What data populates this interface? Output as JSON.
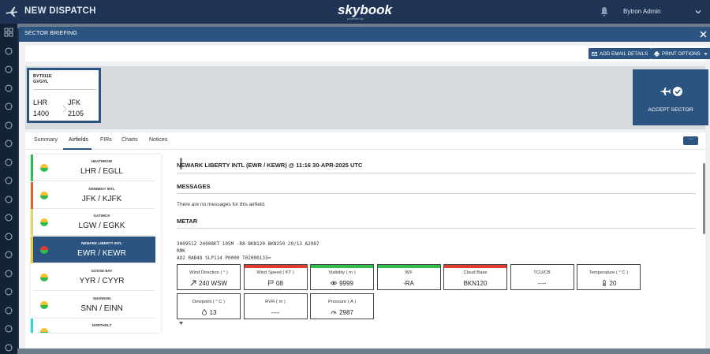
{
  "app": {
    "title": "NEW DISPATCH",
    "brand": "skybook",
    "brand_sub": "powered by",
    "user": "Bytron Admin"
  },
  "sidebar": {
    "icons": [
      "grid-icon",
      "plane-icon",
      "plane-depart-icon",
      "globe-icon",
      "calendar-icon",
      "list-icon",
      "plane-arrive-icon",
      "folder-icon",
      "pin-icon",
      "map-icon",
      "clipboard-icon",
      "table-icon",
      "chart-icon",
      "book-icon",
      "people-icon",
      "users-icon",
      "report-icon",
      "settings-icon"
    ]
  },
  "modal": {
    "title": "SECTOR BRIEFING",
    "email_button": "ADD EMAIL DETAILS",
    "print_button": "PRINT OPTIONS"
  },
  "sector": {
    "flight": "BYT011E",
    "registration": "GVGYL",
    "origin": "LHR",
    "origin_time": "1400",
    "destination": "JFK",
    "destination_time": "2105",
    "accept_label": "ACCEPT SECTOR"
  },
  "tabs": [
    {
      "label": "Summary"
    },
    {
      "label": "Airfields"
    },
    {
      "label": "FIRs"
    },
    {
      "label": "Charts"
    },
    {
      "label": "Notices"
    }
  ],
  "active_tab": "Airfields",
  "more_label": "···",
  "airfields": [
    {
      "name": "HEATHROW",
      "code": "LHR / EGLL",
      "stripe": "#2ebd4e",
      "top": "#f2c230",
      "bottom": "#2ebd4e",
      "selected": false
    },
    {
      "name": "KENNEDY INTL",
      "code": "JFK / KJFK",
      "stripe": "#e2622d",
      "top": "#f2c230",
      "bottom": "#2ebd4e",
      "selected": false
    },
    {
      "name": "GATWICK",
      "code": "LGW / EGKK",
      "stripe": "#d9d96a",
      "top": "#f2c230",
      "bottom": "#2ebd4e",
      "selected": false
    },
    {
      "name": "NEWARK LIBERTY INTL",
      "code": "EWR / KEWR",
      "stripe": "#e8c63a",
      "top": "#e03b2f",
      "bottom": "#2ebd4e",
      "selected": true
    },
    {
      "name": "GOOSE BAY",
      "code": "YYR / CYYR",
      "stripe": "#ffffff",
      "top": "#f2c230",
      "bottom": "#2ebd4e",
      "selected": false
    },
    {
      "name": "SHANNON",
      "code": "SNN / EINN",
      "stripe": "#ffffff",
      "top": "#f2c230",
      "bottom": "#2ebd4e",
      "selected": false
    },
    {
      "name": "NORTHOLT",
      "code": "",
      "stripe": "#3ad1d1",
      "top": "#f2c230",
      "bottom": "#2ebd4e",
      "selected": false
    }
  ],
  "detail": {
    "title": "NEWARK LIBERTY INTL (EWR / KEWR) @ 11:16 30-APR-2025 UTC",
    "messages_heading": "MESSAGES",
    "messages_text": "There are no messages for this airfield.",
    "metar_heading": "METAR",
    "metar_line1": "300951Z 24008KT 10SM -RA BKN120 BKN250 20/13 A2987",
    "metar_line2": "RMK",
    "metar_line3": "AO2 RAB48 SLP114 P0000 T02000133="
  },
  "metar_boxes": [
    {
      "label": "Wind Direction ( ° )",
      "value": "240 WSW",
      "icon": "wind-arrow-icon",
      "bar": ""
    },
    {
      "label": "Wind Speed ( KT )",
      "value": "08",
      "icon": "flag-icon",
      "bar": "#e03b2f"
    },
    {
      "label": "Visibility ( m )",
      "value": "9999",
      "icon": "eye-icon",
      "bar": "#2ebd4e"
    },
    {
      "label": "WX",
      "value": "-RA",
      "icon": "",
      "bar": "#2ebd4e"
    },
    {
      "label": "Cloud Base",
      "value": "BKN120",
      "icon": "",
      "bar": "#e03b2f"
    },
    {
      "label": "TCU/CB",
      "value": "----",
      "icon": "",
      "bar": ""
    },
    {
      "label": "Temperature ( ° C )",
      "value": "20",
      "icon": "thermometer-icon",
      "bar": ""
    },
    {
      "label": "Dewpoint ( ° C )",
      "value": "13",
      "icon": "drop-icon",
      "bar": ""
    },
    {
      "label": "RVR ( m )",
      "value": "----",
      "icon": "",
      "bar": ""
    },
    {
      "label": "Pressure ( A )",
      "value": "2987",
      "icon": "gauge-icon",
      "bar": ""
    }
  ]
}
